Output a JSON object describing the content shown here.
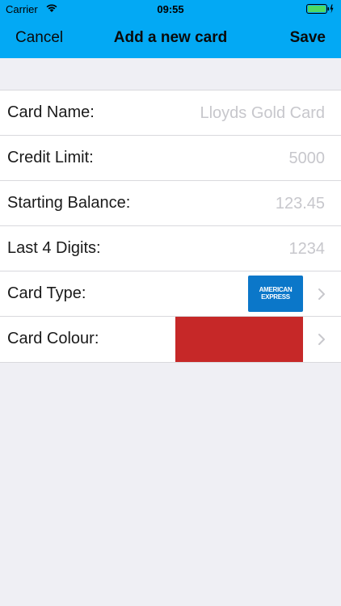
{
  "status_bar": {
    "carrier": "Carrier",
    "time": "09:55"
  },
  "nav": {
    "cancel": "Cancel",
    "title": "Add a new card",
    "save": "Save"
  },
  "form": {
    "card_name": {
      "label": "Card Name:",
      "placeholder": "Lloyds Gold Card"
    },
    "credit_limit": {
      "label": "Credit Limit:",
      "placeholder": "5000"
    },
    "starting_balance": {
      "label": "Starting Balance:",
      "placeholder": "123.45"
    },
    "last_digits": {
      "label": "Last 4 Digits:",
      "placeholder": "1234"
    },
    "card_type": {
      "label": "Card Type:",
      "logo_line1": "AMERICAN",
      "logo_line2": "EXPRESS"
    },
    "card_colour": {
      "label": "Card Colour:",
      "colour": "#c62828"
    }
  },
  "colors": {
    "header": "#03a9f4",
    "background": "#efeff4",
    "amex_blue": "#0b77c9",
    "battery": "#4cd964"
  }
}
